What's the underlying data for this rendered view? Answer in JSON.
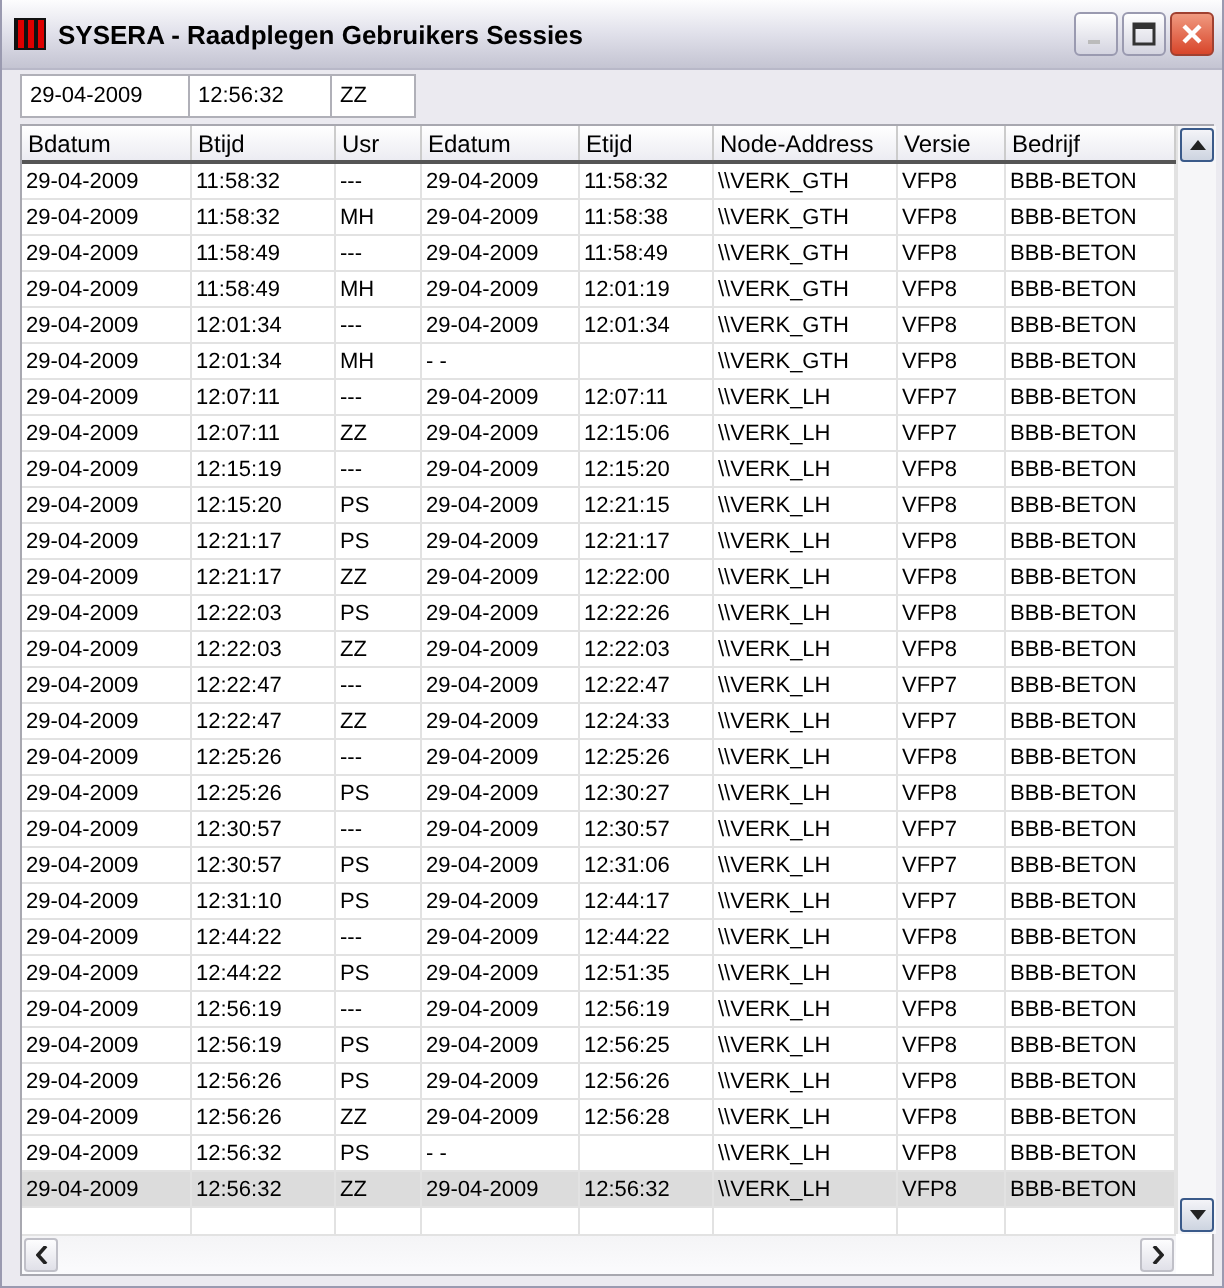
{
  "window": {
    "title": "SYSERA - Raadplegen Gebruikers Sessies"
  },
  "filter": {
    "date": "29-04-2009",
    "time": "12:56:32",
    "user": "ZZ"
  },
  "table": {
    "columns": [
      "Bdatum",
      "Btijd",
      "Usr",
      "Edatum",
      "Etijd",
      "Node-Address",
      "Versie",
      "Bedrijf"
    ],
    "rows": [
      {
        "cells": [
          "29-04-2009",
          "11:58:32",
          "---",
          "29-04-2009",
          "11:58:32",
          "\\\\VERK_GTH",
          "VFP8",
          "BBB-BETON"
        ],
        "selected": false
      },
      {
        "cells": [
          "29-04-2009",
          "11:58:32",
          "MH",
          "29-04-2009",
          "11:58:38",
          "\\\\VERK_GTH",
          "VFP8",
          "BBB-BETON"
        ],
        "selected": false
      },
      {
        "cells": [
          "29-04-2009",
          "11:58:49",
          "---",
          "29-04-2009",
          "11:58:49",
          "\\\\VERK_GTH",
          "VFP8",
          "BBB-BETON"
        ],
        "selected": false
      },
      {
        "cells": [
          "29-04-2009",
          "11:58:49",
          "MH",
          "29-04-2009",
          "12:01:19",
          "\\\\VERK_GTH",
          "VFP8",
          "BBB-BETON"
        ],
        "selected": false
      },
      {
        "cells": [
          "29-04-2009",
          "12:01:34",
          "---",
          "29-04-2009",
          "12:01:34",
          "\\\\VERK_GTH",
          "VFP8",
          "BBB-BETON"
        ],
        "selected": false
      },
      {
        "cells": [
          "29-04-2009",
          "12:01:34",
          "MH",
          "- -",
          null,
          "\\\\VERK_GTH",
          "VFP8",
          "BBB-BETON"
        ],
        "selected": false
      },
      {
        "cells": [
          "29-04-2009",
          "12:07:11",
          "---",
          "29-04-2009",
          "12:07:11",
          "\\\\VERK_LH",
          "VFP7",
          "BBB-BETON"
        ],
        "selected": false
      },
      {
        "cells": [
          "29-04-2009",
          "12:07:11",
          "ZZ",
          "29-04-2009",
          "12:15:06",
          "\\\\VERK_LH",
          "VFP7",
          "BBB-BETON"
        ],
        "selected": false
      },
      {
        "cells": [
          "29-04-2009",
          "12:15:19",
          "---",
          "29-04-2009",
          "12:15:20",
          "\\\\VERK_LH",
          "VFP8",
          "BBB-BETON"
        ],
        "selected": false
      },
      {
        "cells": [
          "29-04-2009",
          "12:15:20",
          "PS",
          "29-04-2009",
          "12:21:15",
          "\\\\VERK_LH",
          "VFP8",
          "BBB-BETON"
        ],
        "selected": false
      },
      {
        "cells": [
          "29-04-2009",
          "12:21:17",
          "PS",
          "29-04-2009",
          "12:21:17",
          "\\\\VERK_LH",
          "VFP8",
          "BBB-BETON"
        ],
        "selected": false
      },
      {
        "cells": [
          "29-04-2009",
          "12:21:17",
          "ZZ",
          "29-04-2009",
          "12:22:00",
          "\\\\VERK_LH",
          "VFP8",
          "BBB-BETON"
        ],
        "selected": false
      },
      {
        "cells": [
          "29-04-2009",
          "12:22:03",
          "PS",
          "29-04-2009",
          "12:22:26",
          "\\\\VERK_LH",
          "VFP8",
          "BBB-BETON"
        ],
        "selected": false
      },
      {
        "cells": [
          "29-04-2009",
          "12:22:03",
          "ZZ",
          "29-04-2009",
          "12:22:03",
          "\\\\VERK_LH",
          "VFP8",
          "BBB-BETON"
        ],
        "selected": false
      },
      {
        "cells": [
          "29-04-2009",
          "12:22:47",
          "---",
          "29-04-2009",
          "12:22:47",
          "\\\\VERK_LH",
          "VFP7",
          "BBB-BETON"
        ],
        "selected": false
      },
      {
        "cells": [
          "29-04-2009",
          "12:22:47",
          "ZZ",
          "29-04-2009",
          "12:24:33",
          "\\\\VERK_LH",
          "VFP7",
          "BBB-BETON"
        ],
        "selected": false
      },
      {
        "cells": [
          "29-04-2009",
          "12:25:26",
          "---",
          "29-04-2009",
          "12:25:26",
          "\\\\VERK_LH",
          "VFP8",
          "BBB-BETON"
        ],
        "selected": false
      },
      {
        "cells": [
          "29-04-2009",
          "12:25:26",
          "PS",
          "29-04-2009",
          "12:30:27",
          "\\\\VERK_LH",
          "VFP8",
          "BBB-BETON"
        ],
        "selected": false
      },
      {
        "cells": [
          "29-04-2009",
          "12:30:57",
          "---",
          "29-04-2009",
          "12:30:57",
          "\\\\VERK_LH",
          "VFP7",
          "BBB-BETON"
        ],
        "selected": false
      },
      {
        "cells": [
          "29-04-2009",
          "12:30:57",
          "PS",
          "29-04-2009",
          "12:31:06",
          "\\\\VERK_LH",
          "VFP7",
          "BBB-BETON"
        ],
        "selected": false
      },
      {
        "cells": [
          "29-04-2009",
          "12:31:10",
          "PS",
          "29-04-2009",
          "12:44:17",
          "\\\\VERK_LH",
          "VFP7",
          "BBB-BETON"
        ],
        "selected": false
      },
      {
        "cells": [
          "29-04-2009",
          "12:44:22",
          "---",
          "29-04-2009",
          "12:44:22",
          "\\\\VERK_LH",
          "VFP8",
          "BBB-BETON"
        ],
        "selected": false
      },
      {
        "cells": [
          "29-04-2009",
          "12:44:22",
          "PS",
          "29-04-2009",
          "12:51:35",
          "\\\\VERK_LH",
          "VFP8",
          "BBB-BETON"
        ],
        "selected": false
      },
      {
        "cells": [
          "29-04-2009",
          "12:56:19",
          "---",
          "29-04-2009",
          "12:56:19",
          "\\\\VERK_LH",
          "VFP8",
          "BBB-BETON"
        ],
        "selected": false
      },
      {
        "cells": [
          "29-04-2009",
          "12:56:19",
          "PS",
          "29-04-2009",
          "12:56:25",
          "\\\\VERK_LH",
          "VFP8",
          "BBB-BETON"
        ],
        "selected": false
      },
      {
        "cells": [
          "29-04-2009",
          "12:56:26",
          "PS",
          "29-04-2009",
          "12:56:26",
          "\\\\VERK_LH",
          "VFP8",
          "BBB-BETON"
        ],
        "selected": false
      },
      {
        "cells": [
          "29-04-2009",
          "12:56:26",
          "ZZ",
          "29-04-2009",
          "12:56:28",
          "\\\\VERK_LH",
          "VFP8",
          "BBB-BETON"
        ],
        "selected": false
      },
      {
        "cells": [
          "29-04-2009",
          "12:56:32",
          "PS",
          "- -",
          null,
          "\\\\VERK_LH",
          "VFP8",
          "BBB-BETON"
        ],
        "selected": false
      },
      {
        "cells": [
          "29-04-2009",
          "12:56:32",
          "ZZ",
          "29-04-2009",
          "12:56:32",
          "\\\\VERK_LH",
          "VFP8",
          "BBB-BETON"
        ],
        "selected": true
      }
    ]
  }
}
